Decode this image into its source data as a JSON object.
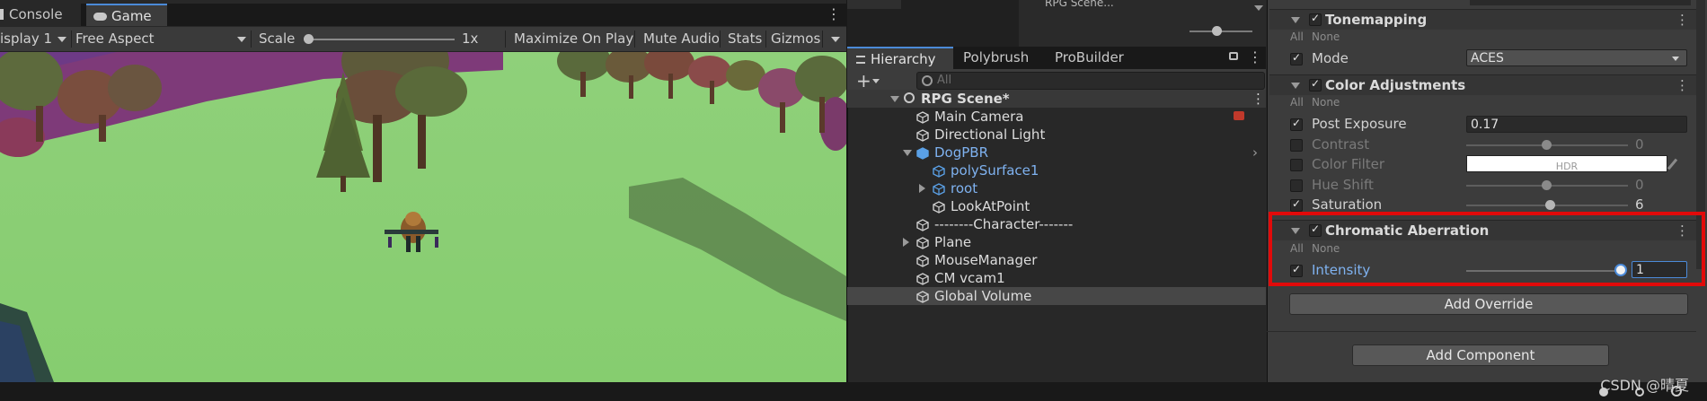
{
  "game_panel": {
    "tabs": [
      {
        "label": "Console",
        "icon": "console-icon"
      },
      {
        "label": "Game",
        "icon": "gamepad-icon"
      }
    ],
    "toolbar": {
      "display": "isplay 1",
      "aspect": "Free Aspect",
      "scale_label": "Scale",
      "scale_value": "1x",
      "maximize_on_play": "Maximize On Play",
      "mute_audio": "Mute Audio",
      "stats": "Stats",
      "gizmos": "Gizmos"
    }
  },
  "scene_header": {
    "scene_label": "RPG Scene..."
  },
  "hierarchy": {
    "tabs": [
      "Hierarchy",
      "Polybrush",
      "ProBuilder"
    ],
    "search_placeholder": "All",
    "scene_root": "RPG Scene*",
    "items": [
      {
        "label": "Main Camera",
        "depth": 1,
        "foldout": "none",
        "prefab": false
      },
      {
        "label": "Directional Light",
        "depth": 1,
        "foldout": "none",
        "prefab": false
      },
      {
        "label": "DogPBR",
        "depth": 1,
        "foldout": "open",
        "prefab": true
      },
      {
        "label": "polySurface1",
        "depth": 2,
        "foldout": "none",
        "prefab": true
      },
      {
        "label": "root",
        "depth": 2,
        "foldout": "closed",
        "prefab": true
      },
      {
        "label": "LookAtPoint",
        "depth": 2,
        "foldout": "none",
        "prefab": false
      },
      {
        "label": "--------Character-------",
        "depth": 1,
        "foldout": "none",
        "prefab": false
      },
      {
        "label": "Plane",
        "depth": 1,
        "foldout": "closed",
        "prefab": false
      },
      {
        "label": "MouseManager",
        "depth": 1,
        "foldout": "none",
        "prefab": false
      },
      {
        "label": "CM vcam1",
        "depth": 1,
        "foldout": "none",
        "prefab": false
      },
      {
        "label": "Global Volume",
        "depth": 1,
        "foldout": "none",
        "prefab": false,
        "selected": true
      }
    ]
  },
  "inspector": {
    "all_label": "All",
    "none_label": "None",
    "tonemapping": {
      "title": "Tonemapping",
      "mode_label": "Mode",
      "mode_value": "ACES"
    },
    "color_adjustments": {
      "title": "Color Adjustments",
      "post_exposure_label": "Post Exposure",
      "post_exposure_value": "0.17",
      "contrast_label": "Contrast",
      "contrast_value": "0",
      "color_filter_label": "Color Filter",
      "color_filter_value": "HDR",
      "hue_shift_label": "Hue Shift",
      "hue_shift_value": "0",
      "saturation_label": "Saturation",
      "saturation_value": "6"
    },
    "chromatic_aberration": {
      "title": "Chromatic Aberration",
      "intensity_label": "Intensity",
      "intensity_value": "1"
    },
    "add_override": "Add Override",
    "add_component": "Add Component"
  },
  "watermark": "CSDN @晴夏",
  "colors": {
    "accent_blue": "#4b8ad8",
    "highlight_red": "#e10a0a",
    "prefab_blue": "#7fb2f0"
  }
}
